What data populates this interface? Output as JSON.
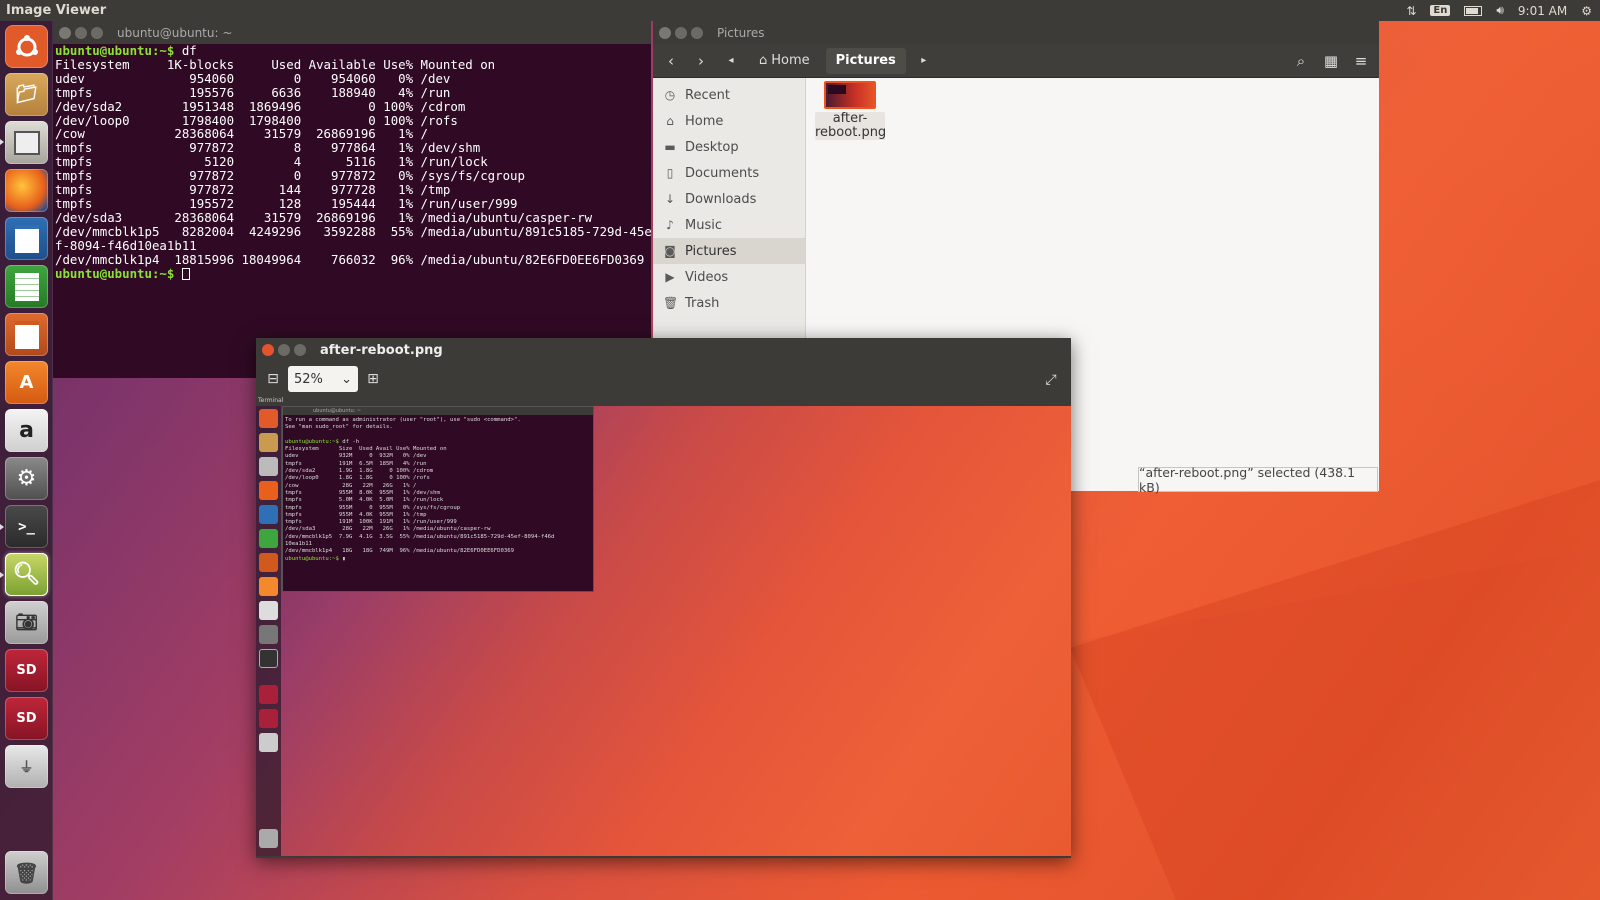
{
  "topbar": {
    "title": "Image Viewer",
    "lang": "En",
    "time": "9:01 AM"
  },
  "launcher": [
    "ubuntu-logo",
    "files",
    "file-cabinet",
    "firefox",
    "writer",
    "calc",
    "impress",
    "software-center",
    "amazon",
    "system-settings",
    "terminal",
    "image-viewer",
    "camera",
    "sd-card",
    "sd-card",
    "usb-drive",
    "trash"
  ],
  "terminal": {
    "title": "ubuntu@ubuntu: ~",
    "prompt": "ubuntu@ubuntu:~$",
    "command": " df",
    "output": "Filesystem     1K-blocks     Used Available Use% Mounted on\nudev              954060        0    954060   0% /dev\ntmpfs             195576     6636    188940   4% /run\n/dev/sda2        1951348  1869496         0 100% /cdrom\n/dev/loop0       1798400  1798400         0 100% /rofs\n/cow            28368064    31579  26869196   1% /\ntmpfs             977872        8    977864   1% /dev/shm\ntmpfs               5120        4      5116   1% /run/lock\ntmpfs             977872        0    977872   0% /sys/fs/cgroup\ntmpfs             977872      144    977728   1% /tmp\ntmpfs             195572      128    195444   1% /run/user/999\n/dev/sda3       28368064    31579  26869196   1% /media/ubuntu/casper-rw\n/dev/mmcblk1p5   8282004  4249296   3592288  55% /media/ubuntu/891c5185-729d-45e\nf-8094-f46d10ea1b11\n/dev/mmcblk1p4  18815996 18049964    766032  96% /media/ubuntu/82E6FD0EE6FD0369"
  },
  "files": {
    "title": "Pictures",
    "breadcrumbs": [
      "Home",
      "Pictures"
    ],
    "sidebar": [
      {
        "icon": "clock-icon",
        "label": "Recent"
      },
      {
        "icon": "home-icon",
        "label": "Home"
      },
      {
        "icon": "folder-icon",
        "label": "Desktop"
      },
      {
        "icon": "document-icon",
        "label": "Documents"
      },
      {
        "icon": "download-icon",
        "label": "Downloads"
      },
      {
        "icon": "music-icon",
        "label": "Music"
      },
      {
        "icon": "camera-icon",
        "label": "Pictures"
      },
      {
        "icon": "video-icon",
        "label": "Videos"
      },
      {
        "icon": "trash-icon",
        "label": "Trash"
      }
    ],
    "file": {
      "name": "after-\nreboot.png"
    },
    "status": "“after-reboot.png” selected (438.1 kB)"
  },
  "viewer": {
    "title": "after-reboot.png",
    "zoom": "52%"
  },
  "mini": {
    "topbar": "Terminal",
    "term_title": "ubuntu@ubuntu: ~",
    "text": "To run a command as administrator (user \"root\"), use \"sudo <command>\".\nSee \"man sudo_root\" for details.\n\n",
    "prompt1": "ubuntu@ubuntu:~$",
    "cmd": " df -h",
    "out": "Filesystem      Size  Used Avail Use% Mounted on\nudev            932M     0  932M   0% /dev\ntmpfs           191M  6.5M  185M   4% /run\n/dev/sda2       1.9G  1.8G     0 100% /cdrom\n/dev/loop0      1.8G  1.8G     0 100% /rofs\n/cow             28G   22M   26G   1% /\ntmpfs           955M  8.0K  955M   1% /dev/shm\ntmpfs           5.0M  4.0K  5.0M   1% /run/lock\ntmpfs           955M     0  955M   0% /sys/fs/cgroup\ntmpfs           955M  4.0K  955M   1% /tmp\ntmpfs           191M  100K  191M   1% /run/user/999\n/dev/sda3        28G   22M   26G   1% /media/ubuntu/casper-rw\n/dev/mmcblk1p5  7.9G  4.1G  3.5G  55% /media/ubuntu/891c5185-729d-45ef-8094-f46d\n10ea1b11\n/dev/mmcblk1p4   18G   18G  749M  96% /media/ubuntu/82E6FD0EE6FD0369",
    "prompt2": "ubuntu@ubuntu:~$"
  }
}
